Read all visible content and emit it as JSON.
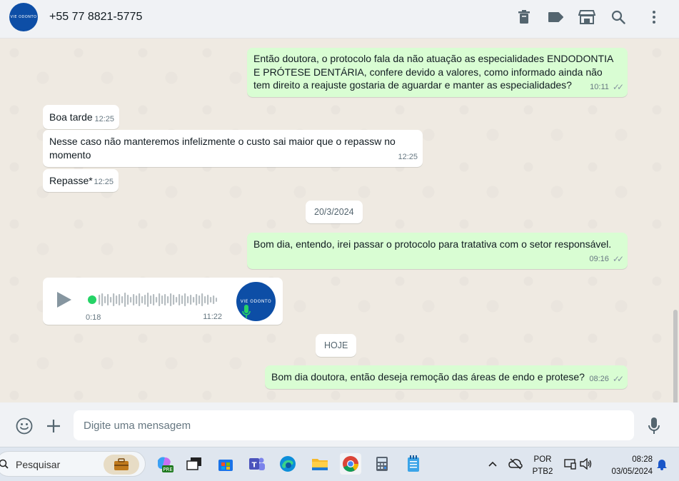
{
  "header": {
    "avatar_text": "VIE ODONTO",
    "contact_name": "+55 77 8821-5775",
    "icons": [
      "delete-icon",
      "label-icon",
      "store-icon",
      "search-icon",
      "menu-icon"
    ]
  },
  "messages": [
    {
      "dir": "out",
      "text": "Então doutora, o protocolo fala da não atuação as especialidades ENDODONTIA E PRÓTESE DENTÁRIA, confere devido a valores, como informado ainda não tem direito a reajuste gostaria de aguardar e manter as especialidades?",
      "time": "10:11",
      "status": "read"
    },
    {
      "dir": "in",
      "text": "Boa tarde",
      "time": "12:25"
    },
    {
      "dir": "in",
      "text": "Nesse caso não manteremos infelizmente o custo sai maior que o repassw no momento",
      "time": "12:25"
    },
    {
      "dir": "in",
      "text": "Repasse*",
      "time": "12:25"
    },
    {
      "dir": "out",
      "text": "Bom dia, entendo, irei passar o protocolo para tratativa com o setor responsável.",
      "time": "09:16",
      "status": "read"
    },
    {
      "dir": "out",
      "text": "Bom dia doutora, então deseja remoção das áreas de endo e protese?",
      "time": "08:26",
      "status": "read"
    }
  ],
  "dates": {
    "d1": "20/3/2024",
    "d2": "HOJE"
  },
  "audio": {
    "duration": "0:18",
    "time": "11:22",
    "avatar_text": "VIE ODONTO"
  },
  "compose": {
    "placeholder": "Digite uma mensagem"
  },
  "taskbar": {
    "search_label": "Pesquisar",
    "lang": "POR",
    "layout": "PTB2",
    "clock_time": "08:28",
    "clock_date": "03/05/2024"
  },
  "colors": {
    "outgoing": "#d9fdd3",
    "incoming": "#ffffff",
    "chat_bg": "#efeae2",
    "accent": "#25d366"
  }
}
